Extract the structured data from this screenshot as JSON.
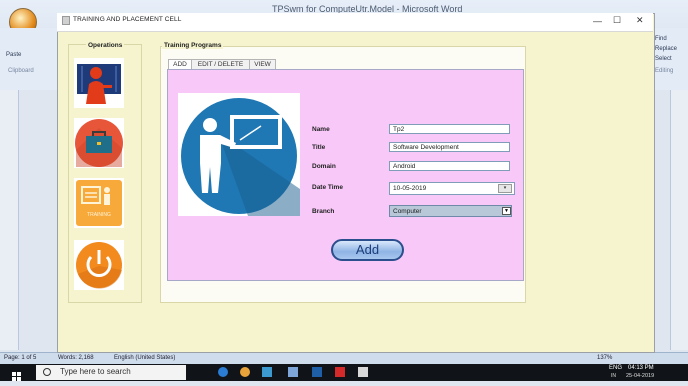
{
  "word": {
    "title": "TPSwm for ComputeUtr.Model - Microsoft Word",
    "ribbon_left": [
      "Paste",
      "Clipboard"
    ],
    "ribbon_right": [
      "Find",
      "Replace",
      "Select",
      "Editing"
    ],
    "status_page": "Page: 1 of 5",
    "status_words": "Words: 2,168",
    "status_lang": "English (United States)",
    "zoom": "137%"
  },
  "taskbar": {
    "search_placeholder": "Type here to search",
    "lang": "ENG",
    "region": "IN",
    "time": "04:13 PM",
    "date": "25-04-2019"
  },
  "app": {
    "title": "TRAINING AND PLACEMENT CELL",
    "window_controls": [
      "—",
      "☐",
      "✕"
    ],
    "operations_title": "Operations",
    "operations": [
      {
        "name": "library",
        "icon": "book-person-icon"
      },
      {
        "name": "jobs",
        "icon": "briefcase-icon"
      },
      {
        "name": "training",
        "icon": "training-icon",
        "label": "TRAINING"
      },
      {
        "name": "logout",
        "icon": "power-icon"
      }
    ],
    "programs_title": "Training Programs",
    "tabs": [
      "ADD",
      "EDIT / DELETE",
      "VIEW"
    ],
    "active_tab": "ADD",
    "form": {
      "name_label": "Name",
      "name_value": "Tp2",
      "title_label": "Title",
      "title_value": "Software Development",
      "domain_label": "Domain",
      "domain_value": "Android",
      "datetime_label": "Date Time",
      "datetime_value": "10-05-2019",
      "branch_label": "Branch",
      "branch_value": "Computer",
      "add_button": "Add"
    },
    "colors": {
      "window_bg": "#f5f4cf",
      "form_bg": "#f8c8f8",
      "photo_circle": "#1f78b4"
    }
  }
}
